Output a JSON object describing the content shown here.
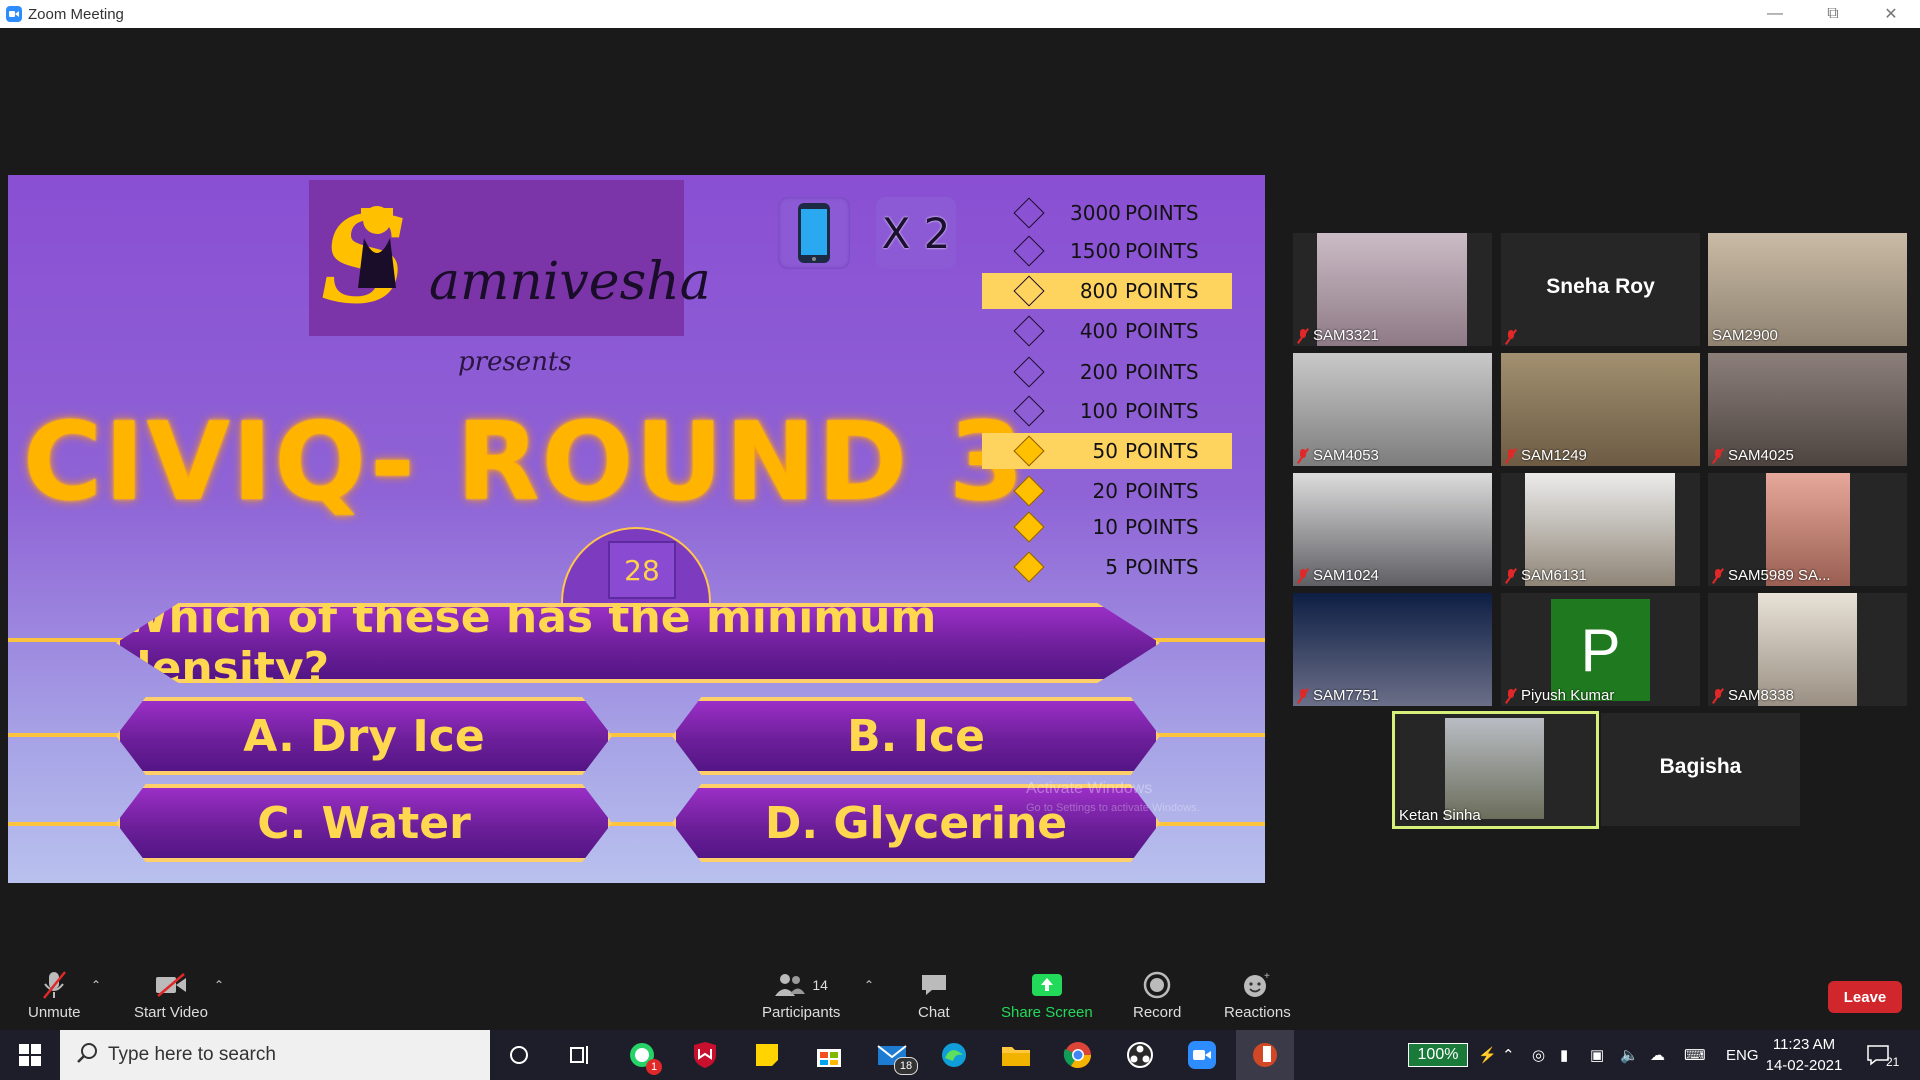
{
  "window": {
    "title": "Zoom Meeting",
    "controls": [
      "minimize",
      "restore",
      "close"
    ]
  },
  "slide": {
    "brand": "amnivesha",
    "brand_initial": "S",
    "presents": "presents",
    "title": "CIVIQ- ROUND 3",
    "lifeline_multiplier": "X 2",
    "timer": "28",
    "question": "Which of these has the minimum density?",
    "options": {
      "a": "A. Dry Ice",
      "b": "B. Ice",
      "c": "C. Water",
      "d": "D. Glycerine"
    },
    "ladder": [
      {
        "value": "3000",
        "unit": "POINTS",
        "highlighted": false,
        "filled": false
      },
      {
        "value": "1500",
        "unit": "POINTS",
        "highlighted": false,
        "filled": false
      },
      {
        "value": "800",
        "unit": "POINTS",
        "highlighted": true,
        "filled": false
      },
      {
        "value": "400",
        "unit": "POINTS",
        "highlighted": false,
        "filled": false
      },
      {
        "value": "200",
        "unit": "POINTS",
        "highlighted": false,
        "filled": false
      },
      {
        "value": "100",
        "unit": "POINTS",
        "highlighted": false,
        "filled": false
      },
      {
        "value": "50",
        "unit": "POINTS",
        "highlighted": true,
        "filled": true
      },
      {
        "value": "20",
        "unit": "POINTS",
        "highlighted": false,
        "filled": true
      },
      {
        "value": "10",
        "unit": "POINTS",
        "highlighted": false,
        "filled": true
      },
      {
        "value": "5",
        "unit": "POINTS",
        "highlighted": false,
        "filled": true
      }
    ],
    "watermark_line1": "Activate Windows",
    "watermark_line2": "Go to Settings to activate Windows."
  },
  "participants_gallery": [
    {
      "name": "SAM3321",
      "muted": true,
      "video": true
    },
    {
      "name": "Sneha Roy",
      "muted": true,
      "video": false
    },
    {
      "name": "SAM2900",
      "muted": false,
      "video": true
    },
    {
      "name": "SAM4053",
      "muted": true,
      "video": true
    },
    {
      "name": "SAM1249",
      "muted": true,
      "video": true
    },
    {
      "name": "SAM4025",
      "muted": true,
      "video": true
    },
    {
      "name": "SAM1024",
      "muted": true,
      "video": true
    },
    {
      "name": "SAM6131",
      "muted": true,
      "video": true
    },
    {
      "name": "SAM5989 SA...",
      "muted": true,
      "video": true
    },
    {
      "name": "SAM7751",
      "muted": true,
      "video": true
    },
    {
      "name": "Piyush Kumar",
      "muted": true,
      "video": false,
      "avatar_letter": "P"
    },
    {
      "name": "SAM8338",
      "muted": true,
      "video": true
    },
    {
      "name": "Ketan Sinha",
      "muted": false,
      "video": true,
      "active_speaker": true
    },
    {
      "name": "Bagisha",
      "muted": false,
      "video": false
    }
  ],
  "toolbar": {
    "unmute": "Unmute",
    "start_video": "Start Video",
    "participants": "Participants",
    "participants_count": "14",
    "chat": "Chat",
    "share_screen": "Share Screen",
    "record": "Record",
    "reactions": "Reactions",
    "leave": "Leave"
  },
  "taskbar": {
    "search_placeholder": "Type here to search",
    "whatsapp_badge": "1",
    "mail_badge": "18",
    "battery": "100%",
    "language": "ENG",
    "time": "11:23 AM",
    "date": "14-02-2021",
    "notifications": "21"
  },
  "colors": {
    "accent_gold": "#ffb400",
    "slide_purple": "#8a4fd3",
    "leave_red": "#d0262c",
    "share_green": "#23d959",
    "active_speaker_border": "#d6f07a"
  }
}
